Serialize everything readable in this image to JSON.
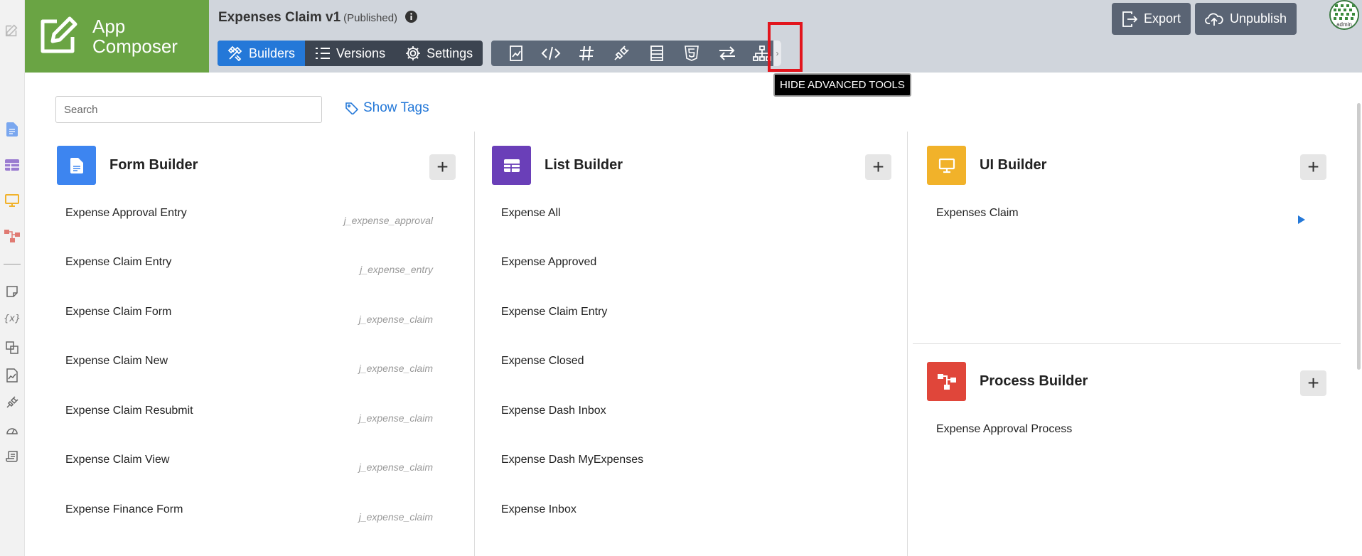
{
  "brand": {
    "line1": "App",
    "line2": "Composer"
  },
  "app": {
    "title": "Expenses Claim v1",
    "status": "(Published)"
  },
  "nav": [
    {
      "label": "Builders",
      "icon": "tools-icon",
      "active": true
    },
    {
      "label": "Versions",
      "icon": "list-icon",
      "active": false
    },
    {
      "label": "Settings",
      "icon": "gear-icon",
      "active": false
    }
  ],
  "tools": [
    "report-icon",
    "code-icon",
    "hash-icon",
    "plugin-icon",
    "table-icon",
    "html5-icon",
    "transfer-icon",
    "sitemap-icon"
  ],
  "tooltip": "HIDE ADVANCED TOOLS",
  "header_buttons": {
    "export": "Export",
    "unpublish": "Unpublish"
  },
  "avatar_label": "admin",
  "search": {
    "placeholder": "Search"
  },
  "show_tags": "Show Tags",
  "form_builder": {
    "title": "Form Builder",
    "color": "#3d85f0",
    "items": [
      {
        "name": "Expense Approval Entry",
        "id": "j_expense_approval"
      },
      {
        "name": "Expense Claim Entry",
        "id": "j_expense_entry"
      },
      {
        "name": "Expense Claim Form",
        "id": "j_expense_claim"
      },
      {
        "name": "Expense Claim New",
        "id": "j_expense_claim"
      },
      {
        "name": "Expense Claim Resubmit",
        "id": "j_expense_claim"
      },
      {
        "name": "Expense Claim View",
        "id": "j_expense_claim"
      },
      {
        "name": "Expense Finance Form",
        "id": "j_expense_claim"
      }
    ]
  },
  "list_builder": {
    "title": "List Builder",
    "color": "#6a3fb8",
    "items": [
      "Expense All",
      "Expense Approved",
      "Expense Claim Entry",
      "Expense Closed",
      "Expense Dash Inbox",
      "Expense Dash MyExpenses",
      "Expense Inbox"
    ]
  },
  "ui_builder": {
    "title": "UI Builder",
    "color": "#f1b22a",
    "items": [
      "Expenses Claim"
    ]
  },
  "process_builder": {
    "title": "Process Builder",
    "color": "#e0463a",
    "items": [
      "Expense Approval Process"
    ]
  },
  "colors": {
    "brand_green": "#6aa444",
    "accent_blue": "#2478d8",
    "header_bg": "#d0d5dc",
    "highlight_red": "#e2151d"
  }
}
